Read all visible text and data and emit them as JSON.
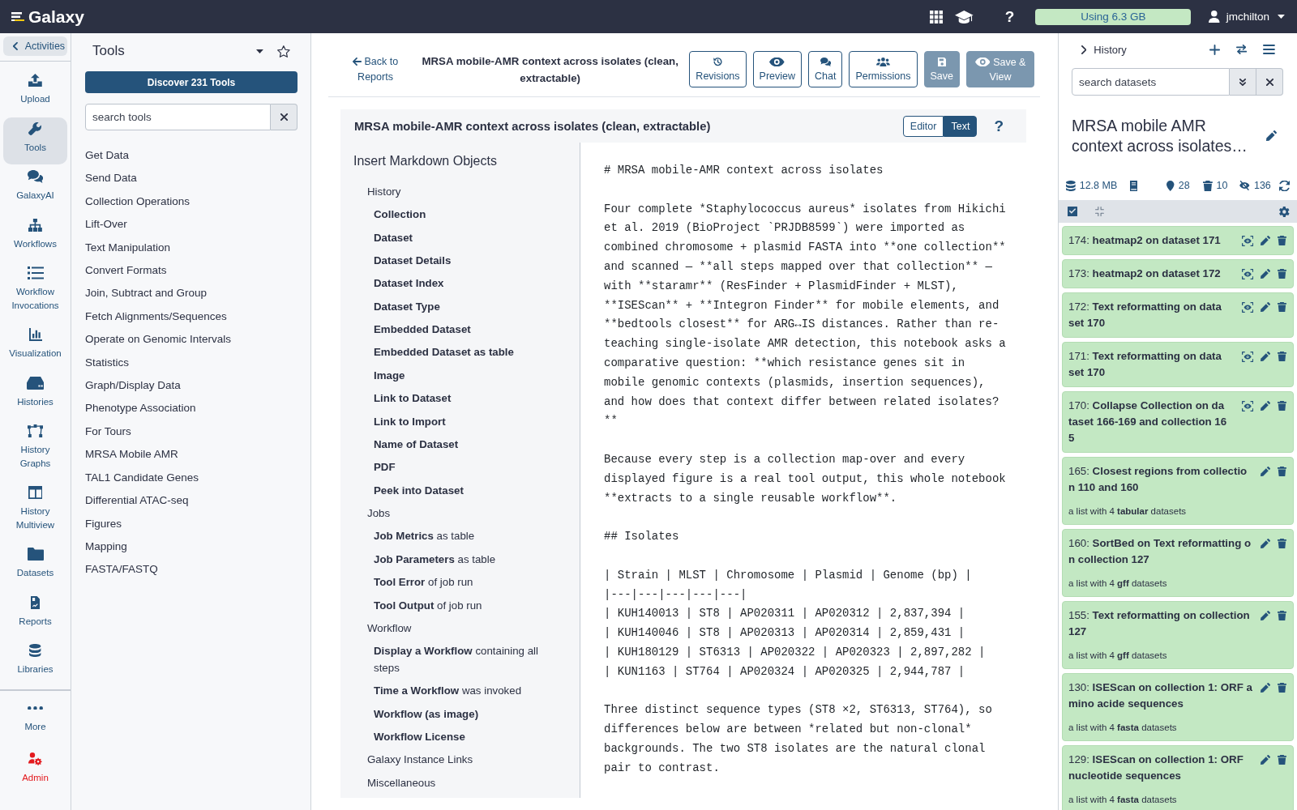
{
  "top_bar": {
    "brand": "Galaxy",
    "help": "?",
    "storage": "Using 6.3 GB",
    "user": "jmchilton"
  },
  "activity_bar": {
    "back": "Activities",
    "items": [
      {
        "label": "Upload",
        "selected": false
      },
      {
        "label": "Tools",
        "selected": true
      },
      {
        "label": "GalaxyAI",
        "selected": false
      },
      {
        "label": "Workflows",
        "selected": false
      },
      {
        "label": "Workflow Invocations",
        "selected": false
      },
      {
        "label": "Visualization",
        "selected": false
      },
      {
        "label": "Histories",
        "selected": false
      },
      {
        "label": "History Graphs",
        "selected": false
      },
      {
        "label": "History Multiview",
        "selected": false
      },
      {
        "label": "Datasets",
        "selected": false
      },
      {
        "label": "Reports",
        "selected": false
      },
      {
        "label": "Libraries",
        "selected": false
      }
    ],
    "bottom_items": [
      {
        "label": "More",
        "kind": "more",
        "selected": false
      },
      {
        "label": "Admin",
        "kind": "admin",
        "selected": false
      }
    ]
  },
  "tool_panel": {
    "title": "Tools",
    "discover": "Discover 231 Tools",
    "search": {
      "placeholder": "search tools"
    },
    "sections": [
      "Get Data",
      "Send Data",
      "Collection Operations",
      "Lift-Over",
      "Text Manipulation",
      "Convert Formats",
      "Join, Subtract and Group",
      "Fetch Alignments/Sequences",
      "Operate on Genomic Intervals",
      "Statistics",
      "Graph/Display Data",
      "Phenotype Association",
      "For Tours",
      "MRSA Mobile AMR",
      "TAL1 Candidate Genes",
      "Differential ATAC-seq",
      "Figures",
      "Mapping",
      "FASTA/FASTQ"
    ]
  },
  "report": {
    "back": "Back to Reports",
    "title": "MRSA mobile-AMR context across isolates (clean, extractable)",
    "buttons": [
      {
        "label": "Revisions",
        "kind": "outline",
        "disabled": false
      },
      {
        "label": "Preview",
        "kind": "outline",
        "disabled": false
      },
      {
        "label": "Chat",
        "kind": "outline",
        "disabled": false
      },
      {
        "label": "Permissions",
        "kind": "outline",
        "disabled": false
      },
      {
        "label": "Save",
        "kind": "primary",
        "disabled": true
      },
      {
        "label": "Save & View",
        "kind": "primary",
        "disabled": true
      }
    ],
    "editor": {
      "title": "MRSA mobile-AMR context across isolates (clean, extractable)",
      "modes": [
        {
          "label": "Editor",
          "selected": false
        },
        {
          "label": "Text",
          "selected": true
        }
      ],
      "help": "?",
      "insert_title": "Insert Markdown Objects",
      "groups": [
        {
          "label": "History",
          "children": [
            {
              "label": "Collection"
            },
            {
              "label": "Dataset"
            },
            {
              "label": "Dataset Details"
            },
            {
              "label": "Dataset Index"
            },
            {
              "label": "Dataset Type"
            },
            {
              "label": "Embedded Dataset"
            },
            {
              "label": "Embedded Dataset as table"
            },
            {
              "label": "Image"
            },
            {
              "label": "Link to Dataset"
            },
            {
              "label": "Link to Import"
            },
            {
              "label": "Name of Dataset"
            },
            {
              "label": "PDF"
            },
            {
              "label": "Peek into Dataset"
            }
          ]
        },
        {
          "label": "Jobs",
          "children": [
            {
              "label": "Job Metrics",
              "suffix": "as table"
            },
            {
              "label": "Job Parameters",
              "suffix": "as table"
            },
            {
              "label": "Tool Error",
              "suffix": "of job run"
            },
            {
              "label": "Tool Output",
              "suffix": "of job run"
            }
          ]
        },
        {
          "label": "Workflow",
          "children": [
            {
              "label": "Display a Workflow",
              "suffix": "containing all steps"
            },
            {
              "label": "Time a Workflow",
              "suffix": "was invoked"
            },
            {
              "label": "Workflow (as image)"
            },
            {
              "label": "Workflow License"
            }
          ]
        },
        {
          "label": "Galaxy Instance Links"
        },
        {
          "label": "Miscellaneous"
        }
      ],
      "markdown": "# MRSA mobile-AMR context across isolates\n\nFour complete *Staphylococcus aureus* isolates from Hikichi et al. 2019 (BioProject `PRJDB8599`) were imported as combined chromosome + plasmid FASTA into **one collection** and scanned — **all steps mapped over that collection** — with **staramr** (ResFinder + PlasmidFinder + MLST), **ISEScan** + **Integron Finder** for mobile elements, and **bedtools closest** for ARG↔IS distances. Rather than re-teaching single-isolate AMR detection, this notebook asks a comparative question: **which resistance genes sit in mobile genomic contexts (plasmids, insertion sequences), and how does that context differ between related isolates?**\n\nBecause every step is a collection map-over and every displayed figure is a real tool output, this whole notebook **extracts to a single reusable workflow**.\n\n## Isolates\n\n| Strain | MLST | Chromosome | Plasmid | Genome (bp) |\n|---|---|---|---|---|\n| KUH140013 | ST8 | AP020311 | AP020312 | 2,837,394 |\n| KUH140046 | ST8 | AP020313 | AP020314 | 2,859,431 |\n| KUH180129 | ST6313 | AP020322 | AP020323 | 2,897,282 |\n| KUN1163 | ST764 | AP020324 | AP020325 | 2,944,787 |\n\nThree distinct sequence types (ST8 ×2, ST6313, ST764), so differences below are between *related but non-clonal* backgrounds. The two ST8 isolates are the natural clonal pair to contrast."
    }
  },
  "history": {
    "header": "History",
    "search": {
      "placeholder": "search datasets"
    },
    "name": "MRSA mobile AMR context across isolates…",
    "size": "12.8 MB",
    "active": "28",
    "deleted": "10",
    "hidden": "136",
    "items": [
      {
        "title": "174: **heatmap2 on dataset 171**",
        "kind": "dataset",
        "ok": true
      },
      {
        "title": "173: **heatmap2 on dataset 172**",
        "kind": "dataset",
        "ok": true
      },
      {
        "title": "172: **Text reformatting on dataset 170**",
        "kind": "dataset",
        "ok": true
      },
      {
        "title": "171: **Text reformatting on dataset 170**",
        "kind": "dataset",
        "ok": true
      },
      {
        "title": "170: **Collapse Collection on dataset 166-169 and collection 165**",
        "kind": "dataset",
        "ok": true
      },
      {
        "title": "165: **Closest regions from collection 110 and 160**",
        "kind": "collection",
        "ok": true,
        "description": "a list with 4 **tabular** datasets"
      },
      {
        "title": "160: **SortBed on Text reformatting on collection 127**",
        "kind": "collection",
        "ok": true,
        "description": "a list with 4 **gff** datasets"
      },
      {
        "title": "155: **Text reformatting on collection 127**",
        "kind": "collection",
        "ok": true,
        "description": "a list with 4 **gff** datasets"
      },
      {
        "title": "130: **ISEScan on collection 1: ORF amino acide sequences**",
        "kind": "collection",
        "ok": true,
        "description": "a list with 4 **fasta** datasets"
      },
      {
        "title": "129: **ISEScan on collection 1: ORF nucleotide sequences**",
        "kind": "collection",
        "ok": true,
        "description": "a list with 4 **fasta** datasets"
      }
    ]
  }
}
